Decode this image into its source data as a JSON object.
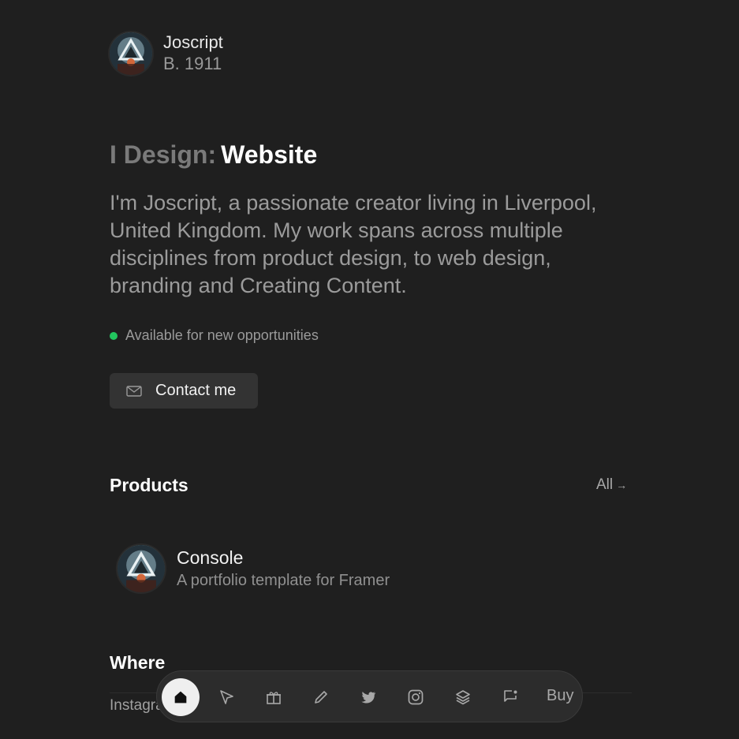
{
  "profile": {
    "name": "Joscript",
    "born": "B. 1911"
  },
  "hero": {
    "prefix": "I Design:",
    "highlight": "Website",
    "bio": "I'm Joscript, a passionate creator living in Liverpool, United Kingdom. My work spans across multiple disciplines from product design, to web design, branding and Creating Content.",
    "status": "Available for new opportunities",
    "status_color": "#22c55e",
    "contact_label": "Contact me"
  },
  "products": {
    "title": "Products",
    "all_label": "All",
    "items": [
      {
        "name": "Console",
        "description": "A portfolio template for Framer"
      }
    ]
  },
  "where": {
    "title": "Where",
    "row_text": "InstagramFollow"
  },
  "dock": {
    "items": [
      "home-icon",
      "cursor-icon",
      "gift-icon",
      "pencil-icon",
      "twitter-icon",
      "instagram-icon",
      "layers-icon",
      "message-icon"
    ],
    "buy_label": "Buy"
  }
}
